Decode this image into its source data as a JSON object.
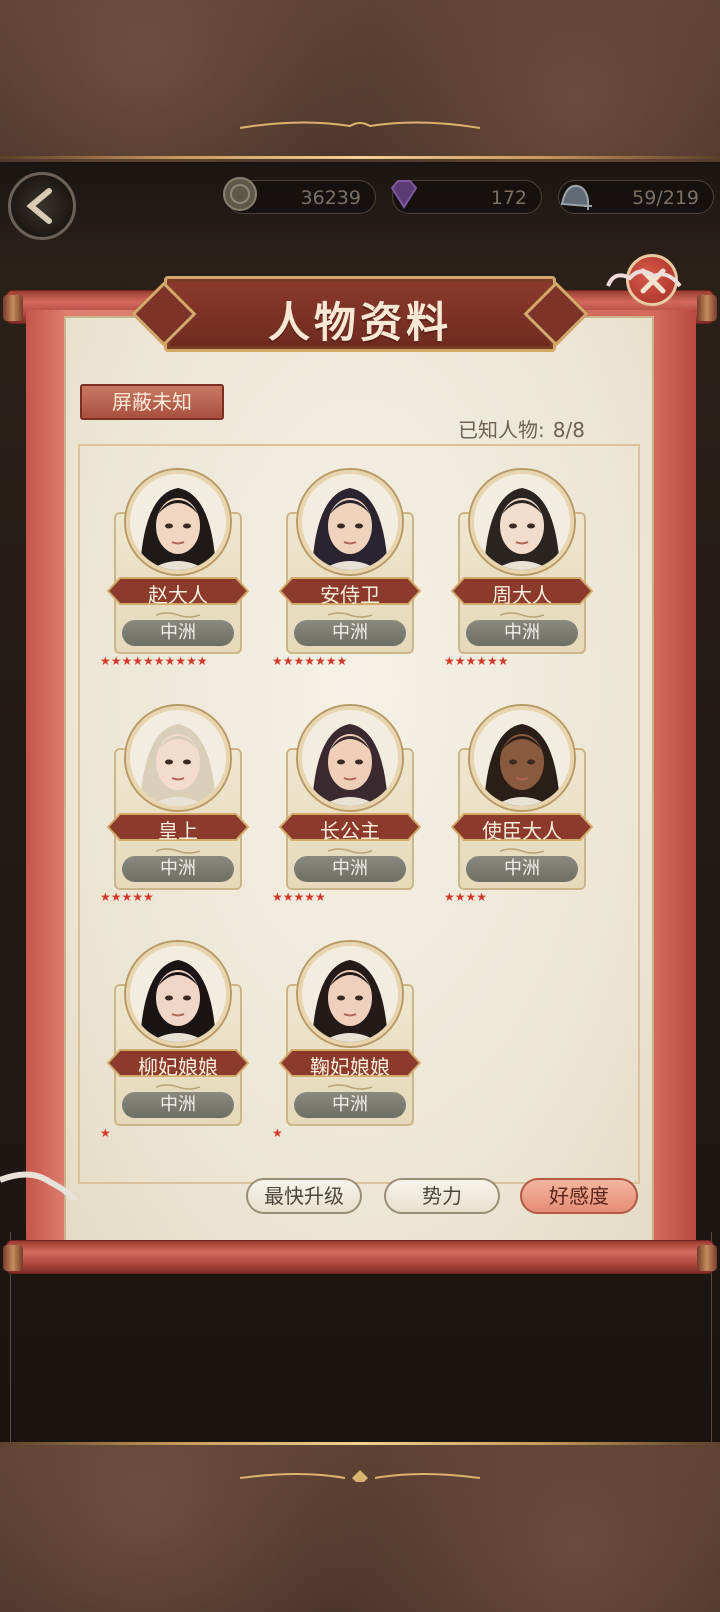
{
  "hud": {
    "coins": "36239",
    "gems": "172",
    "stamina": "59/219",
    "coin_icon": "coin-icon",
    "gem_icon": "gem-icon",
    "stamina_icon": "slipper-icon"
  },
  "panel": {
    "title": "人物资料",
    "hide_unknown_label": "屏蔽未知",
    "known_label": "已知人物:",
    "known_count": "8/8"
  },
  "characters": [
    {
      "name": "赵大人",
      "region": "中洲",
      "stars": 10,
      "stars_text": "★★★★★★★★★★"
    },
    {
      "name": "安侍卫",
      "region": "中洲",
      "stars": 7,
      "stars_text": "★★★★★★★"
    },
    {
      "name": "周大人",
      "region": "中洲",
      "stars": 6,
      "stars_text": "★★★★★★"
    },
    {
      "name": "皇上",
      "region": "中洲",
      "stars": 5,
      "stars_text": "★★★★★"
    },
    {
      "name": "长公主",
      "region": "中洲",
      "stars": 5,
      "stars_text": "★★★★★"
    },
    {
      "name": "使臣大人",
      "region": "中洲",
      "stars": 4,
      "stars_text": "★★★★"
    },
    {
      "name": "柳妃娘娘",
      "region": "中洲",
      "stars": 1,
      "stars_text": "★"
    },
    {
      "name": "鞠妃娘娘",
      "region": "中洲",
      "stars": 1,
      "stars_text": "★"
    }
  ],
  "sort": {
    "fastest_upgrade": "最快升级",
    "power": "势力",
    "affection": "好感度",
    "active": "affection"
  },
  "colors": {
    "scroll_red": "#d3695a",
    "paper": "#f0eadb",
    "gold": "#d2a968",
    "star": "#d03a2a"
  }
}
